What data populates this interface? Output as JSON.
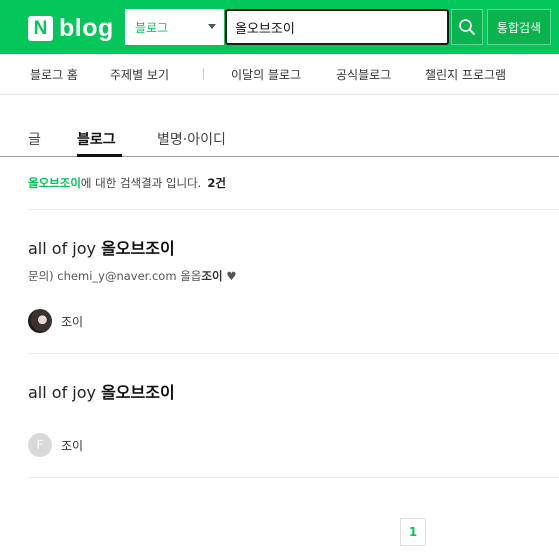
{
  "header": {
    "logo_letter": "N",
    "logo_text": "blog",
    "category": "블로그",
    "search_value": "올오브조이",
    "total_search_label": "통합검색",
    "brand_color": "#03c75a"
  },
  "topnav": {
    "items": [
      "블로그 홈",
      "주제별 보기",
      "이달의 블로그",
      "공식블로그",
      "챌린지 프로그램"
    ]
  },
  "tabs": [
    {
      "label": "글",
      "active": false
    },
    {
      "label": "블로그",
      "active": true
    },
    {
      "label": "별명·아이디",
      "active": false
    }
  ],
  "summary": {
    "keyword": "올오브조이",
    "text": "에 대한 검색결과 입니다.",
    "count": "2건"
  },
  "results": [
    {
      "title_prefix": "all of joy ",
      "title_bold": "올오브조이",
      "desc_prefix": "문의) chemi_y@naver.com 올옵",
      "desc_bold": "조이",
      "desc_suffix": " ♥",
      "author": "조이",
      "avatar": "photo"
    },
    {
      "title_prefix": "all of joy ",
      "title_bold": "올오브조이",
      "author": "조이",
      "avatar_letter": "F"
    }
  ],
  "pagination": {
    "current": "1"
  }
}
